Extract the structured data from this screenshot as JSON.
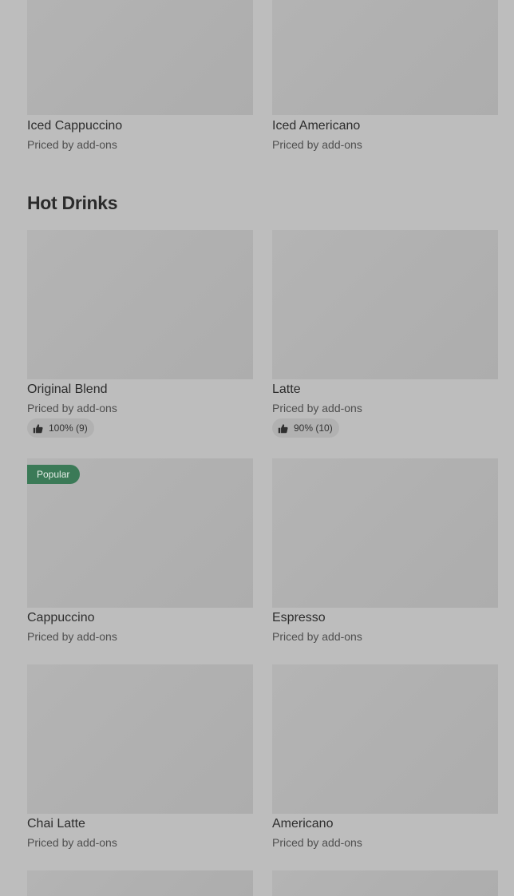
{
  "section": {
    "title": "Hot Drinks"
  },
  "items": {
    "iced_cappuccino": {
      "name": "Iced Cappuccino",
      "price": "Priced by add-ons"
    },
    "iced_americano": {
      "name": "Iced Americano",
      "price": "Priced by add-ons"
    },
    "original_blend": {
      "name": "Original Blend",
      "price": "Priced by add-ons",
      "rating": "100% (9)"
    },
    "latte": {
      "name": "Latte",
      "price": "Priced by add-ons",
      "rating": "90% (10)"
    },
    "cappuccino": {
      "name": "Cappuccino",
      "price": "Priced by add-ons",
      "badge": "Popular"
    },
    "espresso": {
      "name": "Espresso",
      "price": "Priced by add-ons"
    },
    "chai_latte": {
      "name": "Chai Latte",
      "price": "Priced by add-ons"
    },
    "americano": {
      "name": "Americano",
      "price": "Priced by add-ons"
    }
  },
  "icons": {
    "rating": "thumbs-up-icon"
  },
  "colors": {
    "overlay_background": "#bdbdbd",
    "image_placeholder": "#b0b0b0",
    "popular_badge": "#3b7a57",
    "text": "#2d2d2d"
  }
}
